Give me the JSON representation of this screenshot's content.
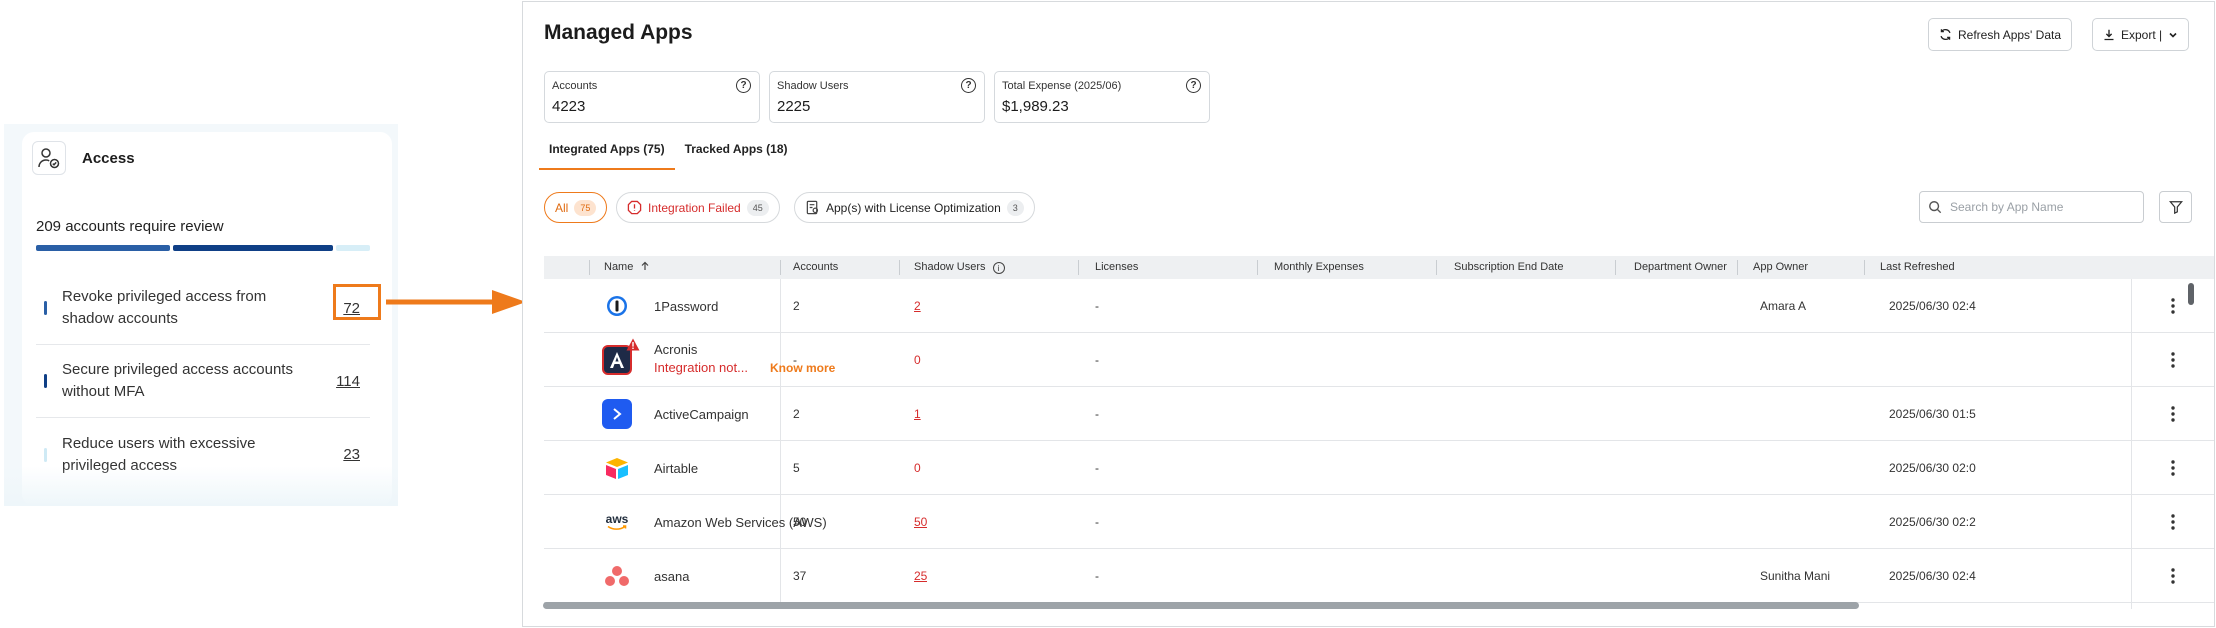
{
  "access": {
    "title": "Access",
    "icon": "user-check-icon",
    "review_text": "209 accounts require review",
    "progress_colors": [
      "#2a5fa6",
      "#0f3f86",
      "#d7eef7"
    ],
    "progress_fractions": [
      0.33,
      0.5,
      0.11
    ],
    "items": [
      {
        "label": "Revoke privileged access from shadow accounts",
        "count": "72",
        "bar_color": "#2a5fa6"
      },
      {
        "label": "Secure privileged access accounts without MFA",
        "count": "114",
        "bar_color": "#0f3f86"
      },
      {
        "label": "Reduce users with excessive privileged access",
        "count": "23",
        "bar_color": "#cfeaf5"
      }
    ]
  },
  "colors": {
    "accent": "#ee7a1b",
    "danger": "#d62c2c"
  },
  "header": {
    "title": "Managed Apps",
    "refresh_label": "Refresh Apps' Data",
    "export_label": "Export |"
  },
  "stats": [
    {
      "label": "Accounts",
      "value": "4223"
    },
    {
      "label": "Shadow Users",
      "value": "2225"
    },
    {
      "label": "Total Expense  (2025/06)",
      "value": "$1,989.23"
    }
  ],
  "tabs": [
    {
      "label": "Integrated Apps (75)"
    },
    {
      "label": "Tracked Apps (18)"
    }
  ],
  "filters": [
    {
      "label": "All",
      "count": "75"
    },
    {
      "label": "Integration Failed",
      "count": "45"
    },
    {
      "label": "App(s) with License Optimization",
      "count": "3"
    }
  ],
  "search": {
    "placeholder": "Search by App Name"
  },
  "table": {
    "columns": [
      "Name",
      "Accounts",
      "Shadow Users",
      "Licenses",
      "Monthly Expenses",
      "Subscription End Date",
      "Department Owner",
      "App Owner",
      "Last Refreshed"
    ],
    "rows": [
      {
        "name": "1Password",
        "logo": "onepassword-logo-icon",
        "accounts": "2",
        "shadow": "2",
        "licenses": "-",
        "app_owner": "Amara A",
        "last_refreshed": "2025/06/30 02:4"
      },
      {
        "name": "Acronis",
        "logo": "acronis-logo-icon",
        "status": "Integration not...",
        "status_link": "Know more",
        "accounts": "-",
        "shadow": "0",
        "licenses": "-",
        "app_owner": "",
        "last_refreshed": ""
      },
      {
        "name": "ActiveCampaign",
        "logo": "activecampaign-logo-icon",
        "accounts": "2",
        "shadow": "1",
        "licenses": "-",
        "app_owner": "",
        "last_refreshed": "2025/06/30 01:5"
      },
      {
        "name": "Airtable",
        "logo": "airtable-logo-icon",
        "accounts": "5",
        "shadow": "0",
        "licenses": "-",
        "app_owner": "",
        "last_refreshed": "2025/06/30 02:0"
      },
      {
        "name": "Amazon Web Services (AWS)",
        "logo": "aws-logo-icon",
        "logo_text": "aws",
        "accounts": "50",
        "shadow": "50",
        "licenses": "-",
        "app_owner": "",
        "last_refreshed": "2025/06/30 02:2"
      },
      {
        "name": "asana",
        "logo": "asana-logo-icon",
        "accounts": "37",
        "shadow": "25",
        "licenses": "-",
        "app_owner": "Sunitha Mani",
        "last_refreshed": "2025/06/30 02:4"
      }
    ]
  }
}
